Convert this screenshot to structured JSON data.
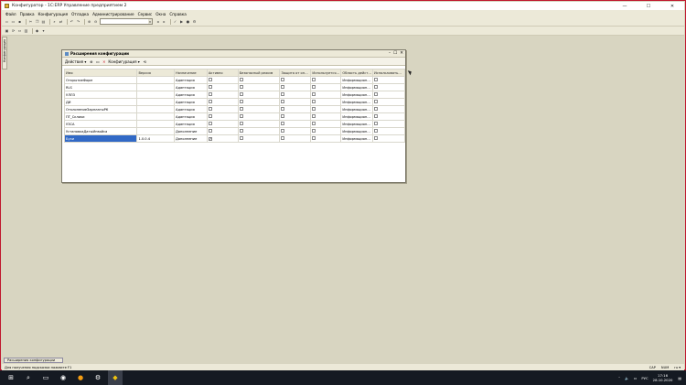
{
  "window": {
    "title": "Конфигуратор - 1С:ERP Управление предприятием 2",
    "controls": [
      "—",
      "☐",
      "✕"
    ]
  },
  "menu": [
    "Файл",
    "Правка",
    "Конфигурация",
    "Отладка",
    "Администрирование",
    "Сервис",
    "Окна",
    "Справка"
  ],
  "leftstrip": {
    "label": "Конфигурация"
  },
  "dialog": {
    "title": "Расширения конфигурации",
    "actions_label": "Действия ▾",
    "config_label": "Конфигурация ▾",
    "columns": [
      "Имя",
      "Версия",
      "Назначение",
      "Активно",
      "Безопасный режим",
      "Защита от оп…",
      "Используется…",
      "Область дейст…",
      "Использовать…"
    ],
    "rows": [
      {
        "name": "ОткрытиеФорм",
        "version": "",
        "purpose": "Адаптация",
        "active": false,
        "scope": "Информацион…"
      },
      {
        "name": "RLS",
        "version": "",
        "purpose": "Адаптация",
        "active": false,
        "scope": "Информацион…"
      },
      {
        "name": "УЛЛ3",
        "version": "",
        "purpose": "Адаптация",
        "active": false,
        "scope": "Информацион…"
      },
      {
        "name": "ДИ",
        "version": "",
        "purpose": "Адаптация",
        "active": false,
        "scope": "Информацион…"
      },
      {
        "name": "ОтклонениеЗарплатыРК",
        "version": "",
        "purpose": "Адаптация",
        "active": false,
        "scope": "Информацион…"
      },
      {
        "name": "ПТ_Склики",
        "version": "",
        "purpose": "Адаптация",
        "active": false,
        "scope": "Информацион…"
      },
      {
        "name": "УЗСА",
        "version": "",
        "purpose": "Адаптация",
        "active": false,
        "scope": "Информацион…"
      },
      {
        "name": "УстановкаДатыИнвойса",
        "version": "",
        "purpose": "Дополнение",
        "active": false,
        "scope": "Информацион…"
      },
      {
        "name": "Бухи",
        "version": "1.0.0.4",
        "purpose": "Дополнение",
        "active": true,
        "scope": "Информацион…",
        "selected": true
      }
    ]
  },
  "window_tab": "Расширения конфигурации",
  "status": {
    "hint": "Для получения подсказки нажмите F1",
    "cap": "CAP",
    "num": "NUM",
    "lang": "ru ▾"
  },
  "taskbar": {
    "lang": "РУС",
    "time": "17:16",
    "date": "28.10.2020"
  }
}
